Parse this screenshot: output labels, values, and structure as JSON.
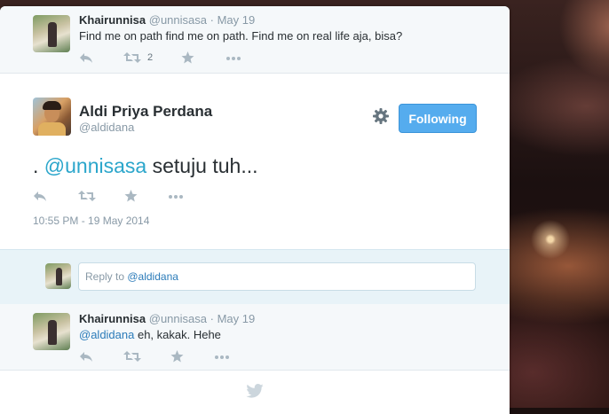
{
  "conversation": {
    "previous_tweet": {
      "name": "Khairunnisa",
      "handle": "@unnisasa",
      "time": "· May 19",
      "text": "Find me on path find me on path. Find me on real life aja, bisa?",
      "retweet_count": "2"
    },
    "main_tweet": {
      "name": "Aldi Priya Perdana",
      "handle": "@aldidana",
      "follow_label": "Following",
      "text_prefix": ". ",
      "mention": "@unnisasa",
      "text_suffix": " setuju tuh...",
      "timestamp": "10:55 PM - 19 May 2014"
    },
    "reply": {
      "prefix": "Reply to ",
      "mention": "@aldidana"
    },
    "reply_tweet": {
      "name": "Khairunnisa",
      "handle": "@unnisasa",
      "time": "· May 19",
      "mention": "@aldidana",
      "text": " eh, kakak. Hehe"
    }
  },
  "icons": {
    "reply": "reply-icon",
    "retweet": "retweet-icon",
    "favorite": "star-icon",
    "more": "more-icon",
    "settings": "gear-icon",
    "brand": "twitter-bird-icon"
  },
  "colors": {
    "accent": "#55acee",
    "link": "#2b7bb9",
    "muted": "#8899a6"
  }
}
